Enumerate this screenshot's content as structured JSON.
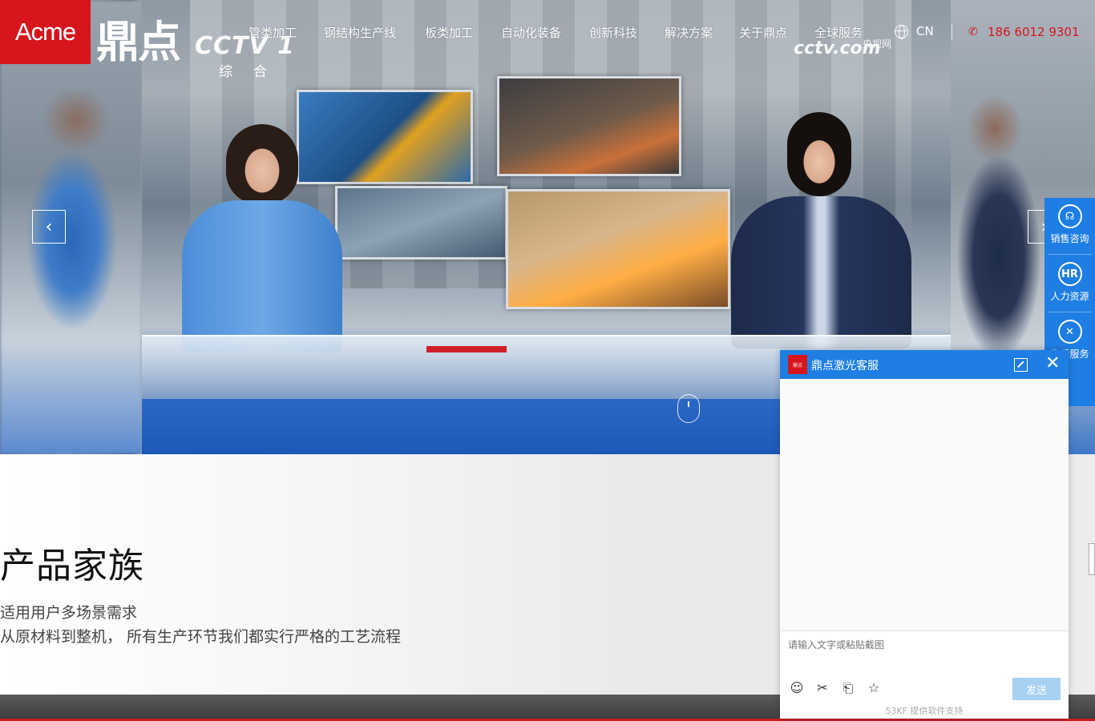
{
  "header": {
    "logo_text": "Acme",
    "logo_cn": "鼎点",
    "nav": [
      "管类加工",
      "钢结构生产线",
      "板类加工",
      "自动化装备",
      "创新科技",
      "解决方案",
      "关于鼎点",
      "全球服务"
    ],
    "lang": "CN",
    "phone": "186 6012 9301"
  },
  "hero": {
    "cctv_main": "CCTV 1",
    "cctv_sub": "综合",
    "cctv_com": "cctv.com",
    "cctv_com_cn": "央视网"
  },
  "section": {
    "title": "产品家族",
    "line1": "适用用户多场景需求",
    "line2": "从原材料到整机， 所有生产环节我们都实行严格的工艺流程"
  },
  "sidebar": {
    "items": [
      "销售咨询",
      "人力资源",
      "售后服务"
    ]
  },
  "chat": {
    "logo_text": "鼎点",
    "title": "鼎点激光客服",
    "placeholder": "请输入文字或粘贴截图",
    "send": "发送",
    "footer": "53KF 提供软件支持"
  },
  "colors": {
    "brand_red": "#d7151d",
    "accent_blue": "#1e7ee3"
  }
}
